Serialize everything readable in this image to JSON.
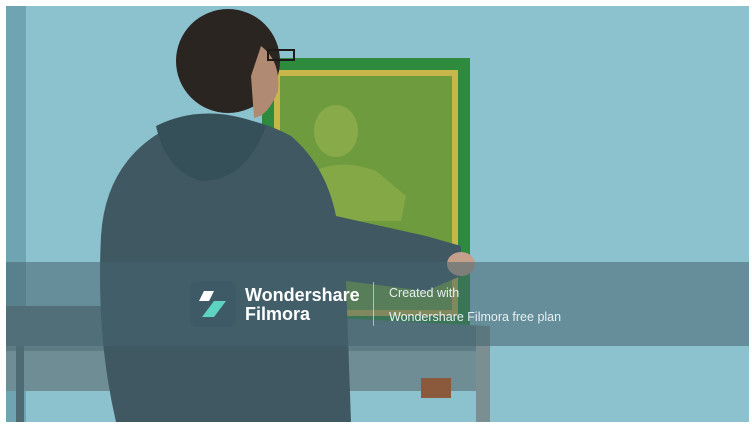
{
  "watermark": {
    "brand_line1": "Wondershare",
    "brand_line2": "Filmora",
    "caption_line1": "Created with",
    "caption_line2": "Wondershare Filmora free plan",
    "logo_icon": "filmora-logo-icon",
    "colors": {
      "band": "#466470",
      "logo_bg": "#3d5a66",
      "logo_accent": "#5fd3c2",
      "text": "#ffffff"
    }
  },
  "scene": {
    "colors": {
      "wall": "#8fc3d0",
      "frame": "#2f8a3a",
      "screen": "#6c9a3e",
      "hoodie": "#3e5660",
      "hair": "#2b2622",
      "shelf": "#5c7a82"
    }
  }
}
